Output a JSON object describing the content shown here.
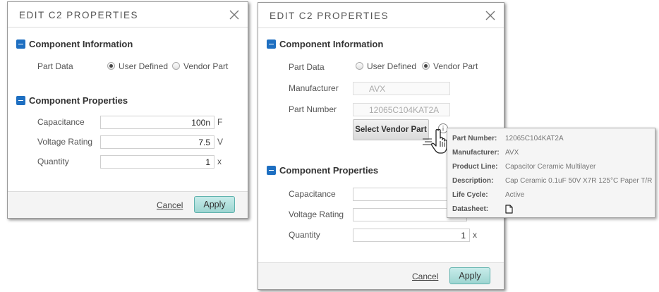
{
  "dialog_left": {
    "title": "EDIT C2 PROPERTIES",
    "section_info": "Component Information",
    "part_data_label": "Part Data",
    "radio_user_defined": "User Defined",
    "radio_vendor_part": "Vendor Part",
    "selected_part_data": "User Defined",
    "section_props": "Component Properties",
    "capacitance_label": "Capacitance",
    "capacitance_value": "100n",
    "capacitance_unit": "F",
    "voltage_label": "Voltage Rating",
    "voltage_value": "7.5",
    "voltage_unit": "V",
    "quantity_label": "Quantity",
    "quantity_value": "1",
    "quantity_unit": "x",
    "cancel_label": "Cancel",
    "apply_label": "Apply"
  },
  "dialog_right": {
    "title": "EDIT C2 PROPERTIES",
    "section_info": "Component Information",
    "part_data_label": "Part Data",
    "radio_user_defined": "User Defined",
    "radio_vendor_part": "Vendor Part",
    "selected_part_data": "Vendor Part",
    "manufacturer_label": "Manufacturer",
    "manufacturer_value": "AVX",
    "part_number_label": "Part Number",
    "part_number_value": "12065C104KAT2A",
    "select_vendor_label": "Select Vendor Part",
    "section_props": "Component Properties",
    "capacitance_label": "Capacitance",
    "voltage_label": "Voltage Rating",
    "quantity_label": "Quantity",
    "quantity_value": "1",
    "quantity_unit": "x",
    "cancel_label": "Cancel",
    "apply_label": "Apply"
  },
  "tooltip": {
    "rows": [
      {
        "key": "Part Number:",
        "value": "12065C104KAT2A"
      },
      {
        "key": "Manufacturer:",
        "value": "AVX"
      },
      {
        "key": "Product Line:",
        "value": "Capacitor Ceramic Multilayer"
      },
      {
        "key": "Description:",
        "value": "Cap Ceramic 0.1uF 50V X7R 125°C Paper T/R"
      },
      {
        "key": "Life Cycle:",
        "value": "Active"
      },
      {
        "key": "Datasheet:",
        "icon": "document-icon"
      }
    ]
  },
  "colors": {
    "accent_blue": "#1e6fc1",
    "apply_teal": "#9dd5d1",
    "border_gray": "#9a9a9a"
  }
}
